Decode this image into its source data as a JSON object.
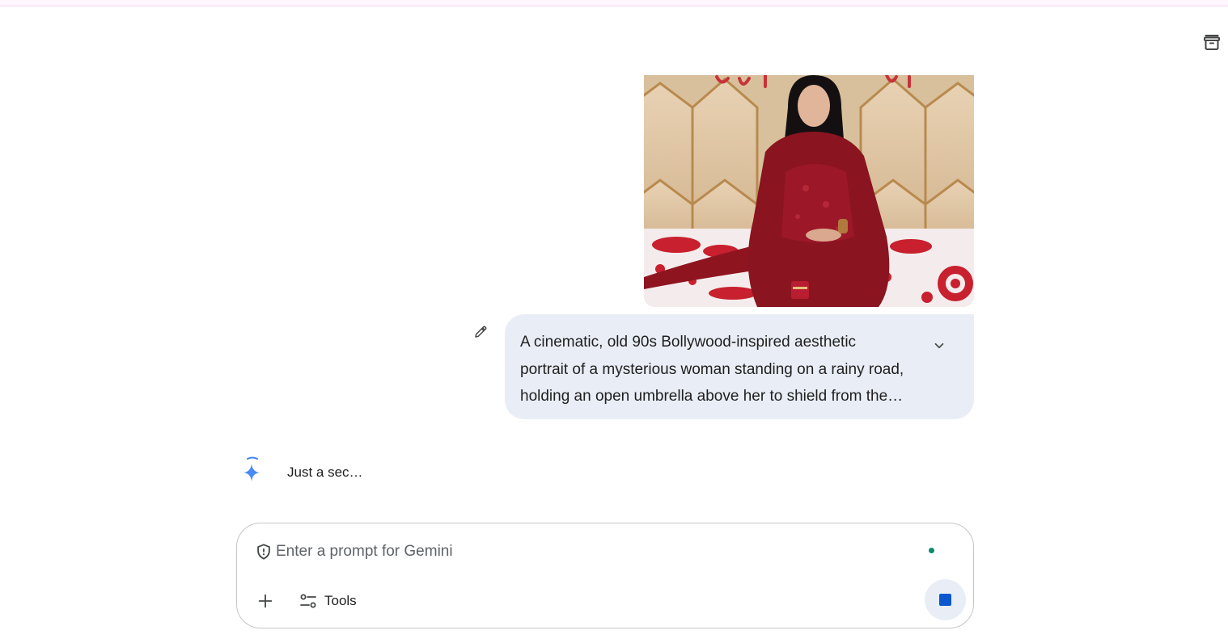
{
  "header": {
    "archive_icon": "archive-box-icon"
  },
  "conversation": {
    "user_message": {
      "image_alt": "Uploaded photo: woman in red outfit seated on bed in front of a beige tufted headboard",
      "image_banner_text": "Happy Birthday",
      "prompt_lines": [
        "A cinematic, old 90s Bollywood-inspired aesthetic",
        "portrait of a mysterious woman standing on a rainy road,",
        "holding an open umbrella above her to shield from the…"
      ],
      "edit_icon": "pencil-icon",
      "expand_icon": "chevron-down-icon"
    },
    "assistant": {
      "icon": "gemini-spark-icon",
      "status_text": "Just a sec…"
    }
  },
  "composer": {
    "placeholder": "Enter a prompt for Gemini",
    "value": "",
    "shield_icon": "shield-icon",
    "add_icon": "plus-icon",
    "tools_icon": "sliders-icon",
    "tools_label": "Tools",
    "stop_icon": "stop-icon",
    "colors": {
      "accent": "#0b57d0",
      "bubble": "#e9eef6",
      "status_dot": "#0b8a6e"
    }
  }
}
